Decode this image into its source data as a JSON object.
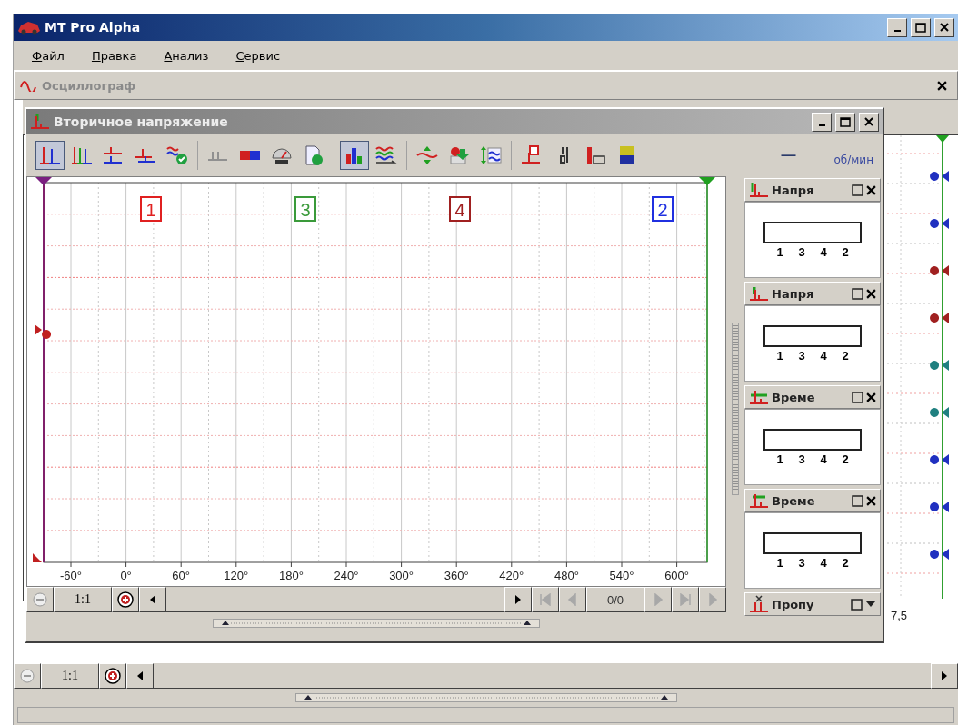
{
  "window": {
    "title": "MT Pro Alpha"
  },
  "menu": [
    {
      "label": "Файл"
    },
    {
      "label": "Правка"
    },
    {
      "label": "Анализ"
    },
    {
      "label": "Сервис"
    }
  ],
  "panel": {
    "title": "Осциллограф"
  },
  "background_plot": {
    "x_tick": "7,5"
  },
  "subwindow": {
    "title": "Вторичное напряжение",
    "toolbar": {
      "groups": [
        {
          "items": [
            {
              "kind": "waveform",
              "selected": true
            },
            {
              "kind": "multi-waveform",
              "selected": false
            },
            {
              "kind": "stacked-waveform",
              "selected": false
            },
            {
              "kind": "offset-waveform",
              "selected": false
            },
            {
              "kind": "waves-check",
              "selected": false
            }
          ]
        },
        {
          "items": [
            {
              "kind": "grey-waveform",
              "selected": false
            },
            {
              "kind": "counter",
              "selected": false
            },
            {
              "kind": "gauge",
              "selected": false
            },
            {
              "kind": "document-check",
              "selected": false
            }
          ]
        },
        {
          "items": [
            {
              "kind": "bar-chart",
              "selected": true
            },
            {
              "kind": "waves-arrow",
              "selected": false
            }
          ]
        },
        {
          "items": [
            {
              "kind": "vertical-arrows",
              "selected": false
            },
            {
              "kind": "palette",
              "selected": false
            },
            {
              "kind": "scale",
              "selected": false
            }
          ]
        },
        {
          "items": [
            {
              "kind": "trigger",
              "selected": false
            },
            {
              "kind": "digits",
              "selected": false
            },
            {
              "kind": "bar-ten",
              "selected": false
            },
            {
              "kind": "small-battery",
              "selected": false
            }
          ]
        }
      ],
      "reading": "—",
      "unit": "об/мин"
    },
    "channels": [
      {
        "label": "1",
        "color": "#e02020"
      },
      {
        "label": "3",
        "color": "#3a9a3a"
      },
      {
        "label": "4",
        "color": "#a02020"
      },
      {
        "label": "2",
        "color": "#2030e0"
      }
    ],
    "x_ticks": [
      "-60°",
      "0°",
      "60°",
      "120°",
      "180°",
      "240°",
      "300°",
      "360°",
      "420°",
      "480°",
      "540°",
      "600°"
    ],
    "zoom": {
      "ratio": "1:1"
    },
    "navigator": {
      "counter": "0/0",
      "buttons": [
        {
          "kind": "first",
          "disabled": true
        },
        {
          "kind": "prev",
          "disabled": true
        },
        {
          "kind": "next",
          "disabled": true
        },
        {
          "kind": "last",
          "disabled": true
        },
        {
          "kind": "play",
          "disabled": true
        }
      ]
    },
    "widgets": [
      {
        "kind": "voltage",
        "title": "Напря",
        "expanded": true,
        "labels": [
          "1",
          "3",
          "4",
          "2"
        ]
      },
      {
        "kind": "voltage-low",
        "title": "Напря",
        "expanded": true,
        "labels": [
          "1",
          "3",
          "4",
          "2"
        ]
      },
      {
        "kind": "time",
        "title": "Време",
        "expanded": true,
        "labels": [
          "1",
          "3",
          "4",
          "2"
        ]
      },
      {
        "kind": "time-alt",
        "title": "Време",
        "expanded": true,
        "labels": [
          "1",
          "3",
          "4",
          "2"
        ]
      },
      {
        "kind": "misfire",
        "title": "Пропу",
        "expanded": false
      }
    ]
  },
  "main_zoom": {
    "ratio": "1:1"
  }
}
